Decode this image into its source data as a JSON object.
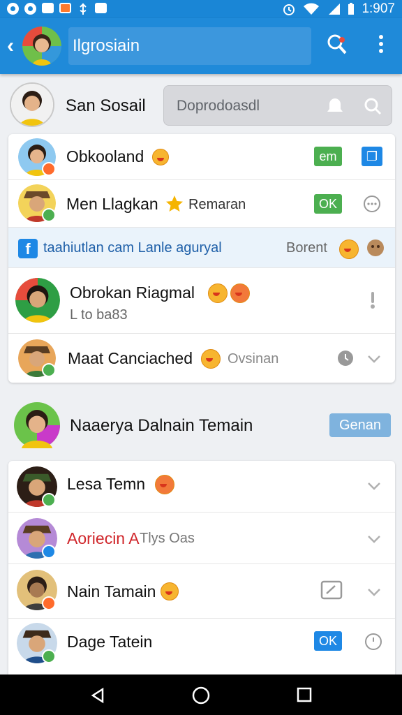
{
  "status_bar": {
    "time": "1:907"
  },
  "app_bar": {
    "title": "Ilgrosiain"
  },
  "profile": {
    "name": "San Sosail"
  },
  "search": {
    "placeholder": "Doprodoasdl"
  },
  "colors": {
    "primary": "#1f8ad9",
    "green": "#4caf50",
    "blue": "#1e88e5"
  },
  "card1": {
    "rows": [
      {
        "name": "Obkooland",
        "pill": "em"
      },
      {
        "name": "Men Llagkan",
        "extra": "Remaran",
        "pill": "OK"
      },
      {
        "text": "taahiutlan cam Lanle aguryal",
        "right": "Borent"
      },
      {
        "name": "Obrokan Riagmal",
        "sub": "L to ba83"
      },
      {
        "name": "Maat Canciached",
        "extra": "Ovsinan"
      }
    ]
  },
  "section": {
    "name": "Naaerya Dalnain Temain",
    "button": "Genan"
  },
  "card2": {
    "rows": [
      {
        "name": "Lesa Temn"
      },
      {
        "name": "Aoriecin A",
        "extra": "Tlys Oas"
      },
      {
        "name": "Nain Tamain"
      },
      {
        "name": "Dage Tatein",
        "pill": "OK"
      }
    ]
  },
  "icons": [
    "back-icon",
    "pin-icon",
    "more-vert-icon",
    "bell-icon",
    "search-icon",
    "chevron-down-icon",
    "facebook-icon",
    "edit-icon"
  ]
}
